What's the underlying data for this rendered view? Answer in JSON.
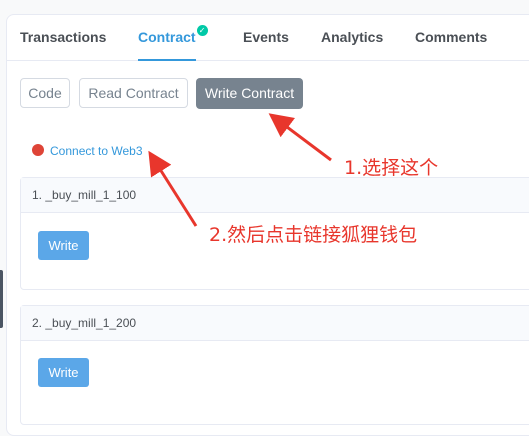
{
  "tabs": [
    {
      "label": "Transactions",
      "active": false
    },
    {
      "label": "Contract",
      "active": true,
      "verified": true
    },
    {
      "label": "Events",
      "active": false
    },
    {
      "label": "Analytics",
      "active": false
    },
    {
      "label": "Comments",
      "active": false
    }
  ],
  "contract_buttons": {
    "code": "Code",
    "read": "Read Contract",
    "write": "Write Contract"
  },
  "connect": {
    "label": "Connect to Web3",
    "status_color": "#de4437"
  },
  "functions": [
    {
      "title": "1. _buy_mill_1_100",
      "button": "Write"
    },
    {
      "title": "2. _buy_mill_1_200",
      "button": "Write"
    }
  ],
  "annotations": {
    "step1": "1.选择这个",
    "step2": "2.然后点击链接狐狸钱包",
    "color": "#e8362c"
  },
  "colors": {
    "accent": "#3498db",
    "active_button_bg": "#77838f",
    "write_button_bg": "#5ba7e8",
    "verified": "#00c9a7"
  }
}
